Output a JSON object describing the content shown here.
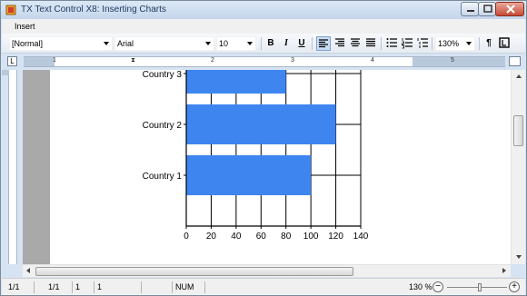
{
  "window": {
    "title": "TX Text Control X8: Inserting Charts",
    "buttons": [
      "minimize",
      "maximize",
      "close"
    ]
  },
  "menu": {
    "items": [
      "Insert"
    ]
  },
  "toolbar": {
    "style": "[Normal]",
    "font": "Arial",
    "size": "10",
    "bold": "B",
    "italic": "I",
    "underline": "U",
    "zoom": "130%",
    "align_active": "left"
  },
  "ruler": {
    "numbers": [
      "1",
      "2",
      "3",
      "4",
      "5"
    ]
  },
  "status": {
    "page": "1/1",
    "section": "1/1",
    "line": "1",
    "column": "1",
    "num": "NUM",
    "zoom": "130 %",
    "zoom_minus": "−",
    "zoom_plus": "+"
  },
  "chart_data": {
    "type": "bar",
    "orientation": "horizontal",
    "categories": [
      "Country 1",
      "Country 2",
      "Country 3"
    ],
    "values": [
      100,
      120,
      80
    ],
    "xlim": [
      0,
      140
    ],
    "xticks": [
      0,
      20,
      40,
      60,
      80,
      100,
      120,
      140
    ],
    "grid": true,
    "bar_color": "#3e85f0",
    "title": "",
    "xlabel": "",
    "ylabel": ""
  }
}
